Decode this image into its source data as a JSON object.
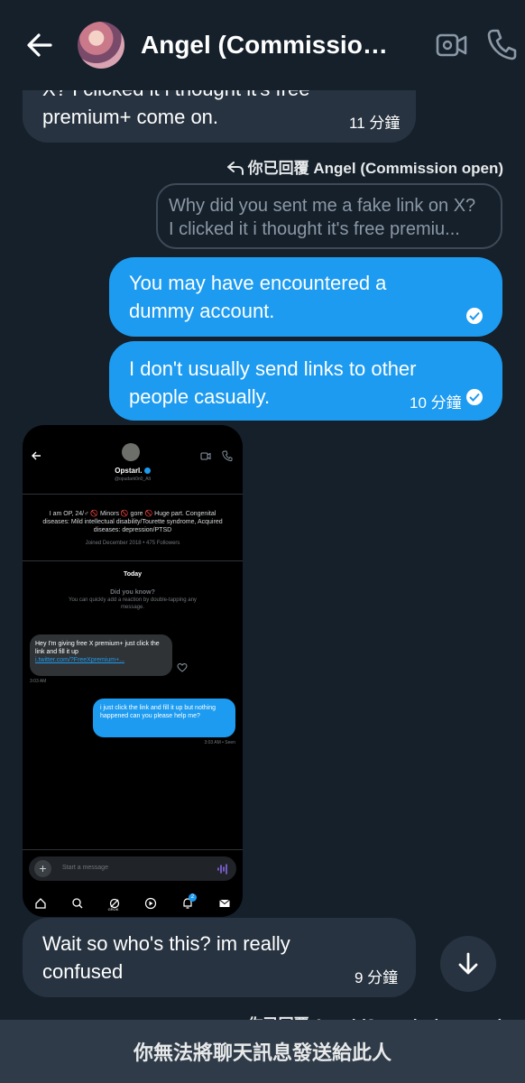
{
  "header": {
    "title": "Angel (Commission ...",
    "back_icon": "arrow-left-icon",
    "video_icon": "video-camera-icon",
    "call_icon": "phone-icon"
  },
  "messages": {
    "m1": {
      "line1": "X? I clicked it i thought it's free",
      "line2": "premium+ come on.",
      "time": "11 分鐘"
    },
    "reply_header": "你已回覆 Angel (Commission open)",
    "quoted": {
      "line1": "Why did you sent me a fake link on X?",
      "line2": "I clicked it i thought it's free premiu..."
    },
    "m2": {
      "line1": "You may have encountered a",
      "line2": "dummy account."
    },
    "m3": {
      "line1": "I don't usually send links to other",
      "line2": "people casually.",
      "time": "10 分鐘"
    },
    "m4": {
      "line1": "Wait so who's this? im really",
      "line2": "confused",
      "time": "9 分鐘"
    },
    "bottom_reply_header": "你已回覆 Angel (Commission open)"
  },
  "attachment": {
    "name": "Opstarl.",
    "handle": "@opudark0n0_Alt",
    "bio": "I am OP, 24/♂ 🚫 Minors 🚫 gore 🚫 Huge part. Congenital diseases: Mild intellectual disability/Tourette syndrome, Acquired diseases: depression/PTSD",
    "joined": "Joined December 2018 • 475 Followers",
    "today": "Today",
    "did_you_know": "Did you know?",
    "tip": "You can quickly add a reaction by double-tapping any message.",
    "incoming_text": "Hey I'm giving free X premium+ just click the link and fill it up",
    "incoming_link": "i.twitter.com/?FreeXpremium+...",
    "incoming_time": "3:03 AM",
    "outgoing_text": "i just click the link and fill it up but nothing happened can you please help me?",
    "outgoing_time": "3:03 AM • Seen",
    "input_placeholder": "Start a message",
    "nav_grok": "GROK",
    "nav_badge": "2"
  },
  "footer": {
    "notice": "你無法將聊天訊息發送給此人"
  },
  "colors": {
    "background": "#15202b",
    "incoming_bubble": "#273340",
    "outgoing_bubble": "#1d9bf0",
    "footer": "#2f3b48"
  }
}
